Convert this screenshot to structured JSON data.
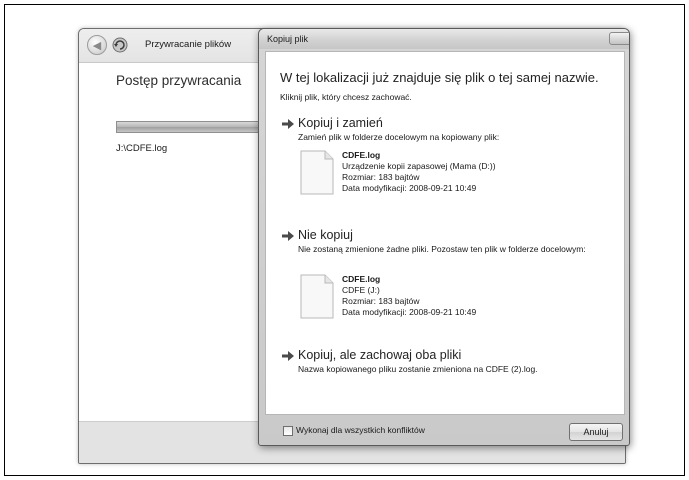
{
  "background_window": {
    "title": "Przywracanie plików",
    "progress_heading": "Postęp przywracania",
    "progress_value": 1.0,
    "file_path": "J:\\CDFE.log"
  },
  "dialog": {
    "title": "Kopiuj plik",
    "heading": "W tej lokalizacji już znajduje się plik o tej samej nazwie.",
    "subheading": "Kliknij plik, który chcesz zachować.",
    "options": [
      {
        "title": "Kopiuj i zamień",
        "description": "Zamień plik w folderze docelowym na kopiowany plik:",
        "file": {
          "name": "CDFE.log",
          "location": "Urządzenie kopii zapasowej (Mama (D:))",
          "size": "Rozmiar: 183 bajtów",
          "modified": "Data modyfikacji: 2008-09-21 10:49"
        }
      },
      {
        "title": "Nie kopiuj",
        "description": "Nie zostaną zmienione żadne pliki. Pozostaw ten plik w folderze docelowym:",
        "file": {
          "name": "CDFE.log",
          "location": "CDFE (J:)",
          "size": "Rozmiar: 183 bajtów",
          "modified": "Data modyfikacji: 2008-09-21 10:49"
        }
      },
      {
        "title": "Kopiuj, ale zachowaj oba pliki",
        "description": "Nazwa kopiowanego pliku zostanie zmieniona na CDFE (2).log."
      }
    ],
    "checkbox_label": "Wykonaj dla wszystkich konfliktów",
    "checkbox_checked": false,
    "cancel_label": "Anuluj"
  },
  "icons": {
    "back": "back-arrow-icon",
    "restore": "restore-files-icon",
    "option_arrow": "green-arrow-icon",
    "file": "document-icon"
  }
}
